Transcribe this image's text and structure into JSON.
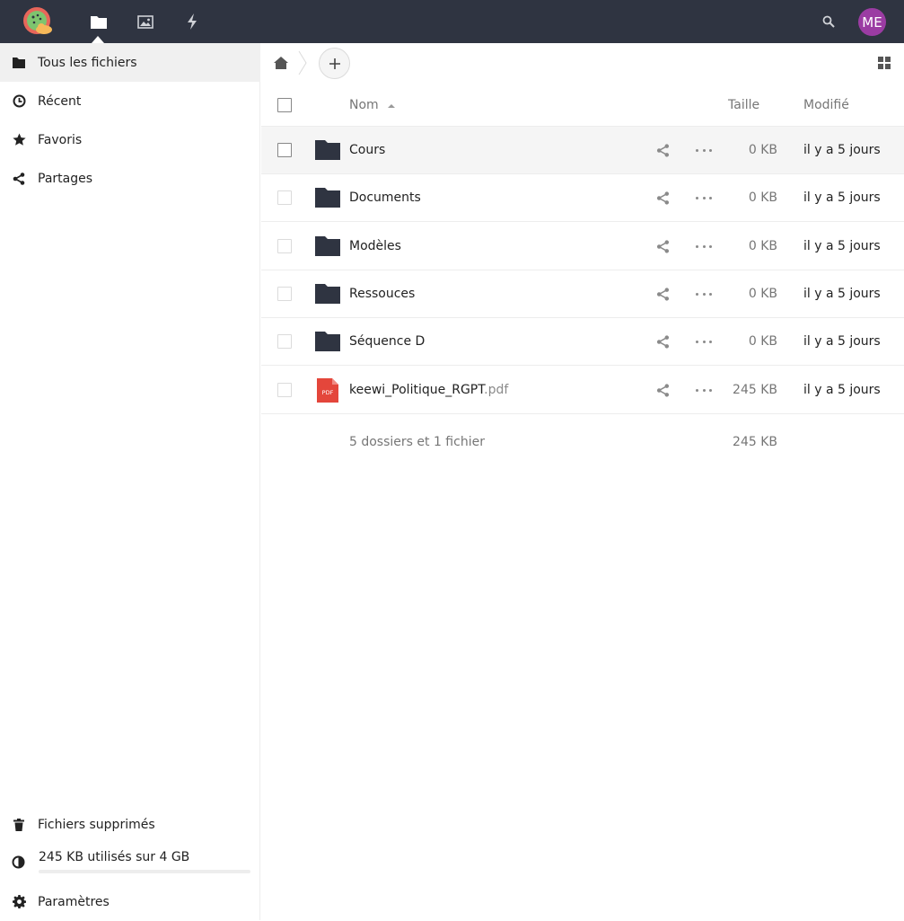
{
  "header": {
    "apps": [
      {
        "name": "files-icon",
        "active": true
      },
      {
        "name": "photos-icon",
        "active": false
      },
      {
        "name": "activity-icon",
        "active": false
      }
    ],
    "avatar_initials": "ME",
    "avatar_color": "#9b3ca3",
    "bar_color": "#2f3441"
  },
  "sidebar": {
    "items": [
      {
        "label": "Tous les fichiers",
        "icon": "folder-icon",
        "active": true
      },
      {
        "label": "Récent",
        "icon": "clock-icon",
        "active": false
      },
      {
        "label": "Favoris",
        "icon": "star-icon",
        "active": false
      },
      {
        "label": "Partages",
        "icon": "share-icon",
        "active": false
      }
    ],
    "trash_label": "Fichiers supprimés",
    "quota_label": "245 KB utilisés sur 4 GB",
    "quota_fraction": 0.0001,
    "settings_label": "Paramètres"
  },
  "table": {
    "col_name": "Nom",
    "col_size": "Taille",
    "col_modified": "Modifié",
    "rows": [
      {
        "name": "Cours",
        "ext": "",
        "type": "folder",
        "size": "0 KB",
        "modified": "il y a 5 jours"
      },
      {
        "name": "Documents",
        "ext": "",
        "type": "folder",
        "size": "0 KB",
        "modified": "il y a 5 jours"
      },
      {
        "name": "Modèles",
        "ext": "",
        "type": "folder",
        "size": "0 KB",
        "modified": "il y a 5 jours"
      },
      {
        "name": "Ressouces",
        "ext": "",
        "type": "folder",
        "size": "0 KB",
        "modified": "il y a 5 jours"
      },
      {
        "name": "Séquence D",
        "ext": "",
        "type": "folder",
        "size": "0 KB",
        "modified": "il y a 5 jours"
      },
      {
        "name": "keewi_Politique_RGPT",
        "ext": ".pdf",
        "type": "pdf",
        "size": "245 KB",
        "modified": "il y a 5 jours"
      }
    ],
    "summary_text": "5 dossiers et 1 fichier",
    "summary_size": "245 KB",
    "pdf_badge": "PDF"
  }
}
